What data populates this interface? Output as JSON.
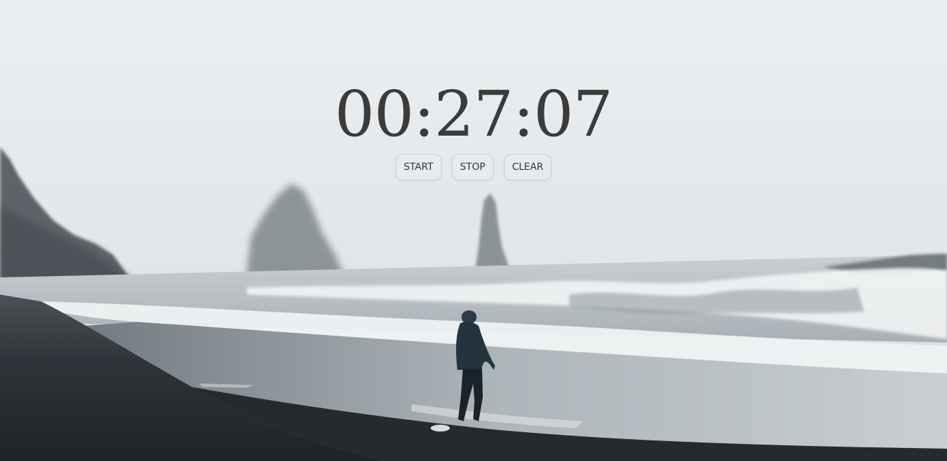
{
  "timer": {
    "display": "00:27:07"
  },
  "controls": {
    "start_label": "START",
    "stop_label": "STOP",
    "clear_label": "CLEAR"
  },
  "colors": {
    "fog": "#e8ecee",
    "sand": "#2b3034",
    "text": "#3b3b3b"
  }
}
